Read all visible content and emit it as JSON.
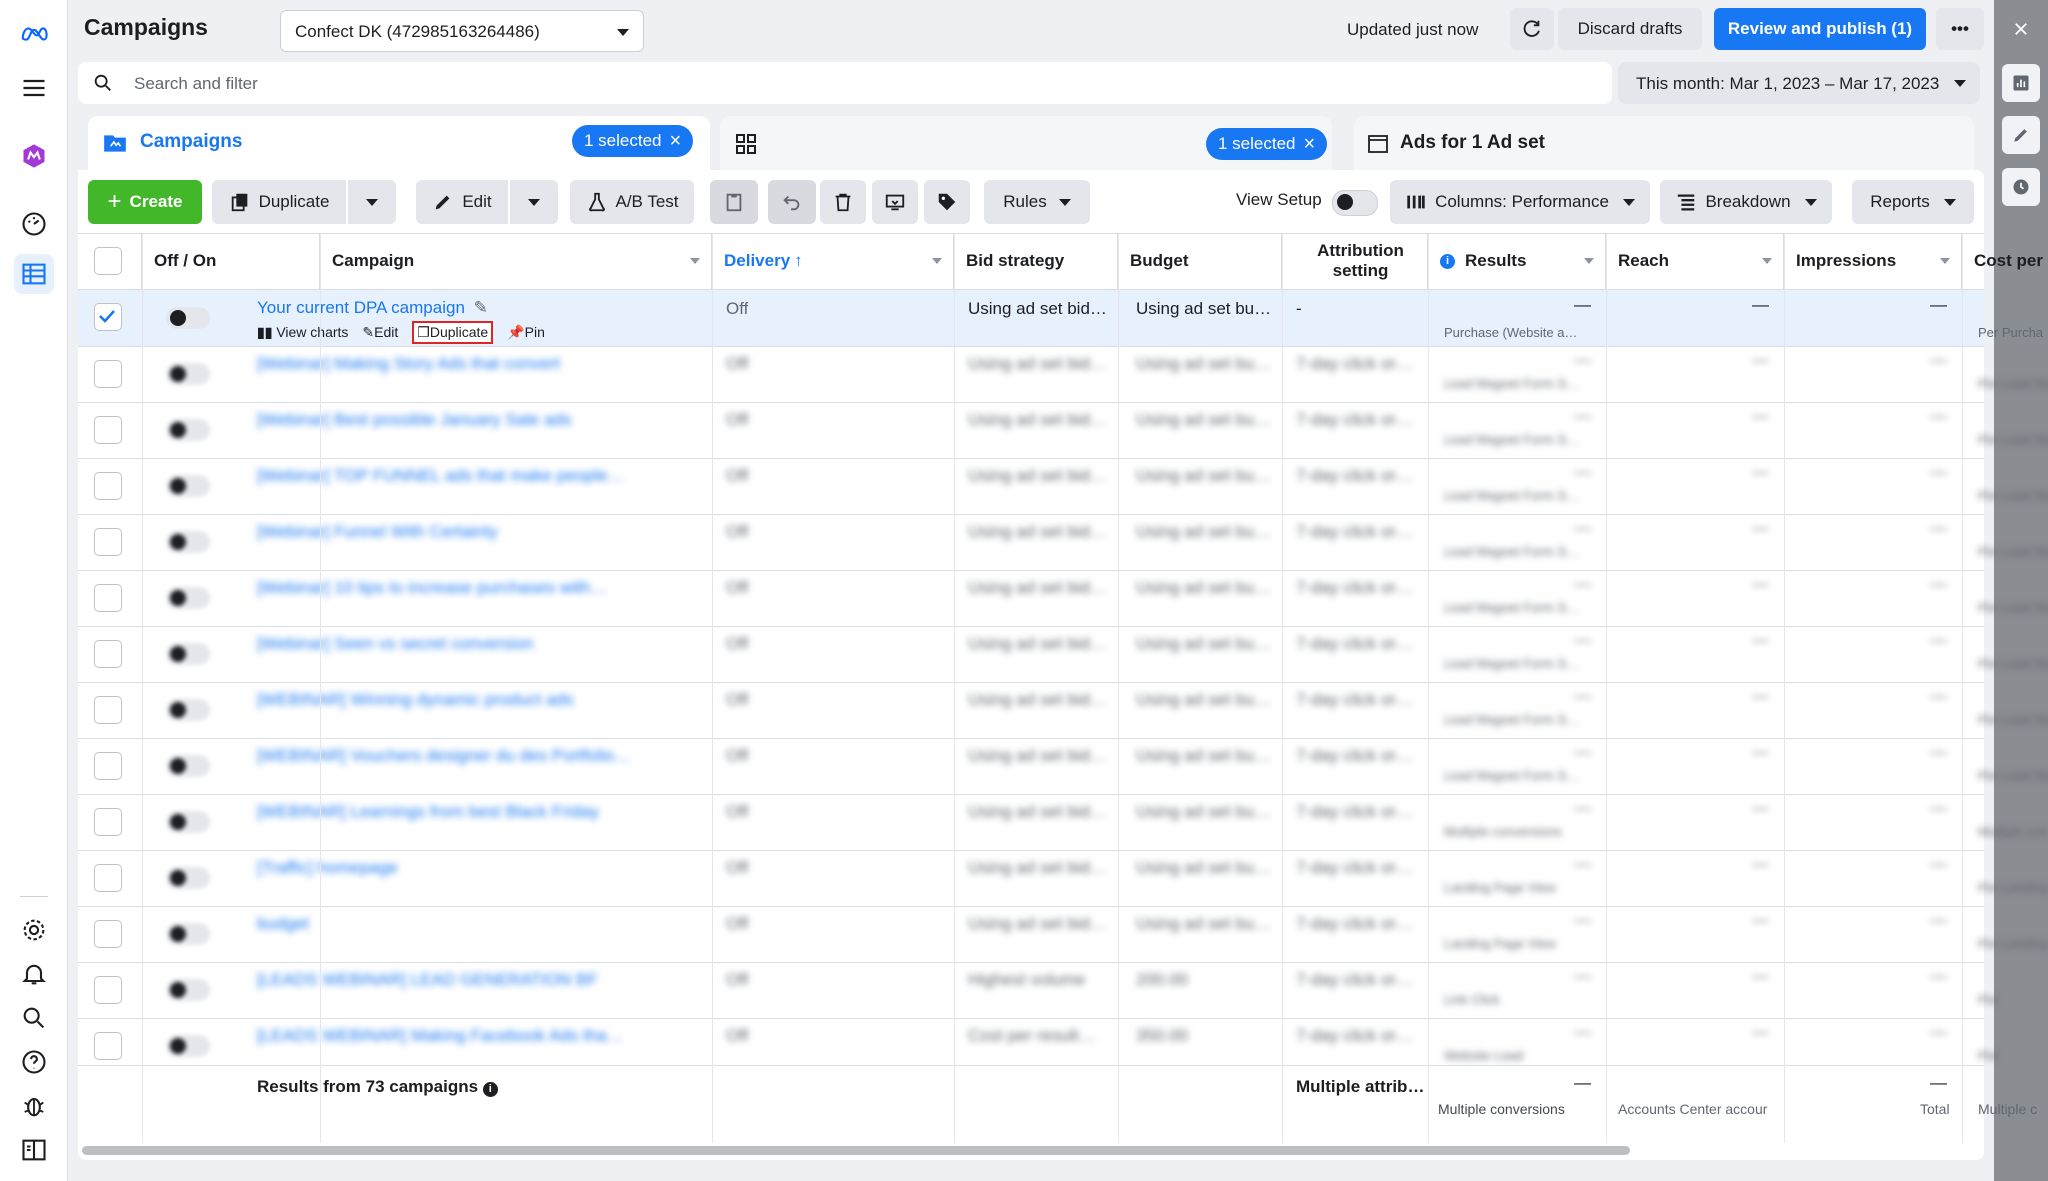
{
  "app": {
    "title": "Campaigns",
    "account": "Confect DK (472985163264486)",
    "status": "Updated just now"
  },
  "actions": {
    "discard": "Discard drafts",
    "publish": "Review and publish (1)",
    "more": "•••"
  },
  "search": {
    "placeholder": "Search and filter"
  },
  "date_range": "This month: Mar 1, 2023 – Mar 17, 2023",
  "tabs": {
    "campaigns": "Campaigns",
    "selected1": "1 selected",
    "selected2": "1 selected",
    "ads": "Ads for 1 Ad set"
  },
  "toolbar": {
    "create": "Create",
    "duplicate": "Duplicate",
    "edit": "Edit",
    "ab_test": "A/B Test",
    "rules": "Rules",
    "view_setup": "View Setup",
    "columns": "Columns: Performance",
    "breakdown": "Breakdown",
    "reports": "Reports"
  },
  "columns": [
    "Off / On",
    "Campaign",
    "Delivery",
    "Bid strategy",
    "Budget",
    "Attribution setting",
    "Results",
    "Reach",
    "Impressions",
    "Cost per res"
  ],
  "selected_row": {
    "campaign": "Your current DPA campaign",
    "actions": [
      "View charts",
      "Edit",
      "Duplicate",
      "Pin"
    ],
    "delivery": "Off",
    "bid_strategy": "Using ad set bid…",
    "budget": "Using ad set bu…",
    "attribution": "-",
    "results": "—",
    "results_sub": "Purchase (Website a…",
    "reach": "—",
    "impressions": "—",
    "cost_sub": "Per Purcha"
  },
  "rows": [
    {
      "campaign": "[Webinar] Making Story Ads that convert",
      "delivery": "Off",
      "bid": "Using ad set bid…",
      "budget": "Using ad set bu…",
      "attr": "7-day click or…",
      "results": "—",
      "results_sub": "Lead Magnet Form S…",
      "cost": "Per Lead Ma"
    },
    {
      "campaign": "[Webinar] Best possible January Sale ads",
      "delivery": "Off",
      "bid": "Using ad set bid…",
      "budget": "Using ad set bu…",
      "attr": "7-day click or…",
      "results": "—",
      "results_sub": "Lead Magnet Form S…",
      "cost": "Per Lead Ma"
    },
    {
      "campaign": "[Webinar] TOP FUNNEL ads that make people…",
      "delivery": "Off",
      "bid": "Using ad set bid…",
      "budget": "Using ad set bu…",
      "attr": "7-day click or…",
      "results": "—",
      "results_sub": "Lead Magnet Form S…",
      "cost": "Per Lead Ma"
    },
    {
      "campaign": "[Webinar] Funnel With Certainty",
      "delivery": "Off",
      "bid": "Using ad set bid…",
      "budget": "Using ad set bu…",
      "attr": "7-day click or…",
      "results": "—",
      "results_sub": "Lead Magnet Form S…",
      "cost": "Per Lead Ma"
    },
    {
      "campaign": "[Webinar] 10 tips to increase purchases with…",
      "delivery": "Off",
      "bid": "Using ad set bid…",
      "budget": "Using ad set bu…",
      "attr": "7-day click or…",
      "results": "—",
      "results_sub": "Lead Magnet Form S…",
      "cost": "Per Lead Ma"
    },
    {
      "campaign": "[Webinar] Seen vs secret conversion",
      "delivery": "Off",
      "bid": "Using ad set bid…",
      "budget": "Using ad set bu…",
      "attr": "7-day click or…",
      "results": "—",
      "results_sub": "Lead Magnet Form S…",
      "cost": "Per Lead Ma"
    },
    {
      "campaign": "[WEBINAR] Winning dynamic product ads",
      "delivery": "Off",
      "bid": "Using ad set bid…",
      "budget": "Using ad set bu…",
      "attr": "7-day click or…",
      "results": "—",
      "results_sub": "Lead Magnet Form S…",
      "cost": "Per Lead Ma"
    },
    {
      "campaign": "[WEBINAR] Vouchers designer du des Portfolio…",
      "delivery": "Off",
      "bid": "Using ad set bid…",
      "budget": "Using ad set bu…",
      "attr": "7-day click or…",
      "results": "—",
      "results_sub": "Lead Magnet Form S…",
      "cost": "Per Lead Ma"
    },
    {
      "campaign": "[WEBINAR] Learnings from best Black Friday",
      "delivery": "Off",
      "bid": "Using ad set bid…",
      "budget": "Using ad set bu…",
      "attr": "7-day click or…",
      "results": "—",
      "results_sub": "Multiple conversions",
      "cost": "Multiple con"
    },
    {
      "campaign": "[Traffic] homepage",
      "delivery": "Off",
      "bid": "Using ad set bid…",
      "budget": "Using ad set bu…",
      "attr": "7-day click or…",
      "results": "—",
      "results_sub": "Landing Page View",
      "cost": "Per Landing P"
    },
    {
      "campaign": "budget",
      "delivery": "Off",
      "bid": "Using ad set bid…",
      "budget": "Using ad set bu…",
      "attr": "7-day click or…",
      "results": "—",
      "results_sub": "Landing Page View",
      "cost": "Per Landing P"
    },
    {
      "campaign": "[LEADS WEBINAR] LEAD GENERATION BF",
      "delivery": "Off",
      "bid": "Highest volume",
      "budget": "200.00",
      "attr": "7-day click or…",
      "results": "—",
      "results_sub": "Link Click",
      "cost": "Per"
    },
    {
      "campaign": "[LEADS WEBINAR] Making Facebook Ads tha…",
      "delivery": "Off",
      "bid": "Cost per result…",
      "budget": "350.00",
      "attr": "7-day click or…",
      "results": "—",
      "results_sub": "Website Lead",
      "cost": "Per"
    }
  ],
  "footer": {
    "summary": "Results from 73 campaigns",
    "attribution": "Multiple attrib…",
    "results": "—",
    "results_sub": "Multiple conversions",
    "reach_sub": "Accounts Center accour",
    "impr": "—",
    "impr_sub": "Total",
    "cost_sub": "Multiple c"
  },
  "colors": {
    "accent": "#1877f2",
    "create": "#42b72a",
    "selected_row": "#e7f0fd",
    "highlight": "#e02424"
  }
}
